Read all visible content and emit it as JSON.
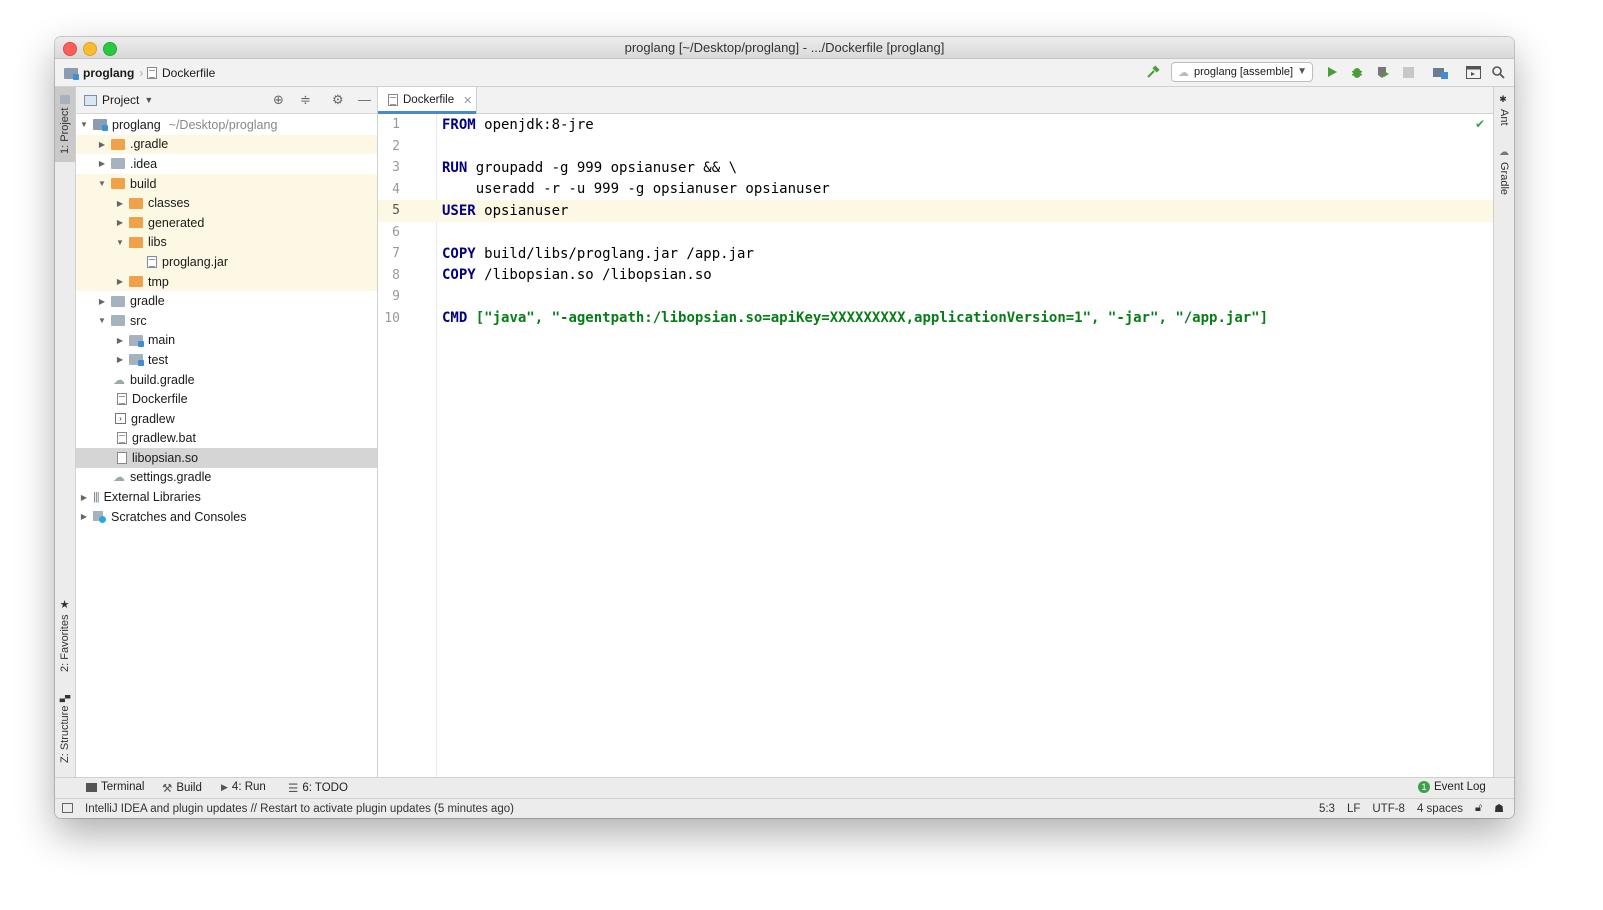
{
  "window": {
    "title": "proglang [~/Desktop/proglang] - .../Dockerfile [proglang]"
  },
  "navbar": {
    "crumbs": [
      "proglang",
      "Dockerfile"
    ],
    "run_config": "proglang [assemble]"
  },
  "left_stripe": {
    "project": "1: Project",
    "favorites": "2: Favorites",
    "structure": "Z: Structure"
  },
  "right_stripe": {
    "ant": "Ant",
    "gradle": "Gradle"
  },
  "project_panel": {
    "title": "Project",
    "tree": [
      {
        "label": "proglang",
        "hint": "~/Desktop/proglang"
      },
      {
        "label": ".gradle"
      },
      {
        "label": ".idea"
      },
      {
        "label": "build"
      },
      {
        "label": "classes"
      },
      {
        "label": "generated"
      },
      {
        "label": "libs"
      },
      {
        "label": "proglang.jar"
      },
      {
        "label": "tmp"
      },
      {
        "label": "gradle"
      },
      {
        "label": "src"
      },
      {
        "label": "main"
      },
      {
        "label": "test"
      },
      {
        "label": "build.gradle"
      },
      {
        "label": "Dockerfile"
      },
      {
        "label": "gradlew"
      },
      {
        "label": "gradlew.bat"
      },
      {
        "label": "libopsian.so"
      },
      {
        "label": "settings.gradle"
      },
      {
        "label": "External Libraries"
      },
      {
        "label": "Scratches and Consoles"
      }
    ]
  },
  "editor": {
    "tab": "Dockerfile",
    "lines": [
      {
        "num": "1",
        "kw": "FROM",
        "text": " openjdk:8-jre",
        "str": ""
      },
      {
        "num": "2",
        "kw": "",
        "text": "",
        "str": ""
      },
      {
        "num": "3",
        "kw": "RUN",
        "text": " groupadd -g 999 opsianuser && \\",
        "str": ""
      },
      {
        "num": "4",
        "kw": "",
        "text": "    useradd -r -u 999 -g opsianuser opsianuser",
        "str": ""
      },
      {
        "num": "5",
        "kw": "USER",
        "text": " opsianuser",
        "str": ""
      },
      {
        "num": "6",
        "kw": "",
        "text": "",
        "str": ""
      },
      {
        "num": "7",
        "kw": "COPY",
        "text": " build/libs/proglang.jar /app.jar",
        "str": ""
      },
      {
        "num": "8",
        "kw": "COPY",
        "text": " /libopsian.so /libopsian.so",
        "str": ""
      },
      {
        "num": "9",
        "kw": "",
        "text": "",
        "str": ""
      },
      {
        "num": "10",
        "kw": "CMD",
        "text": " ",
        "str": "[\"java\", \"-agentpath:/libopsian.so=apiKey=XXXXXXXXX,applicationVersion=1\", \"-jar\", \"/app.jar\"]"
      }
    ]
  },
  "bottom_tools": {
    "terminal": "Terminal",
    "build": "Build",
    "run": "4: Run",
    "todo": "6: TODO",
    "event_log": "Event Log",
    "event_count": "1"
  },
  "status": {
    "message": "IntelliJ IDEA and plugin updates // Restart to activate plugin updates (5 minutes ago)",
    "position": "5:3",
    "line_sep": "LF",
    "encoding": "UTF-8",
    "indent": "4 spaces"
  },
  "colors": {
    "keyword": "#000080",
    "string": "#067d17",
    "accent": "#4a88c7",
    "highlight_row": "#fcf8e3"
  }
}
